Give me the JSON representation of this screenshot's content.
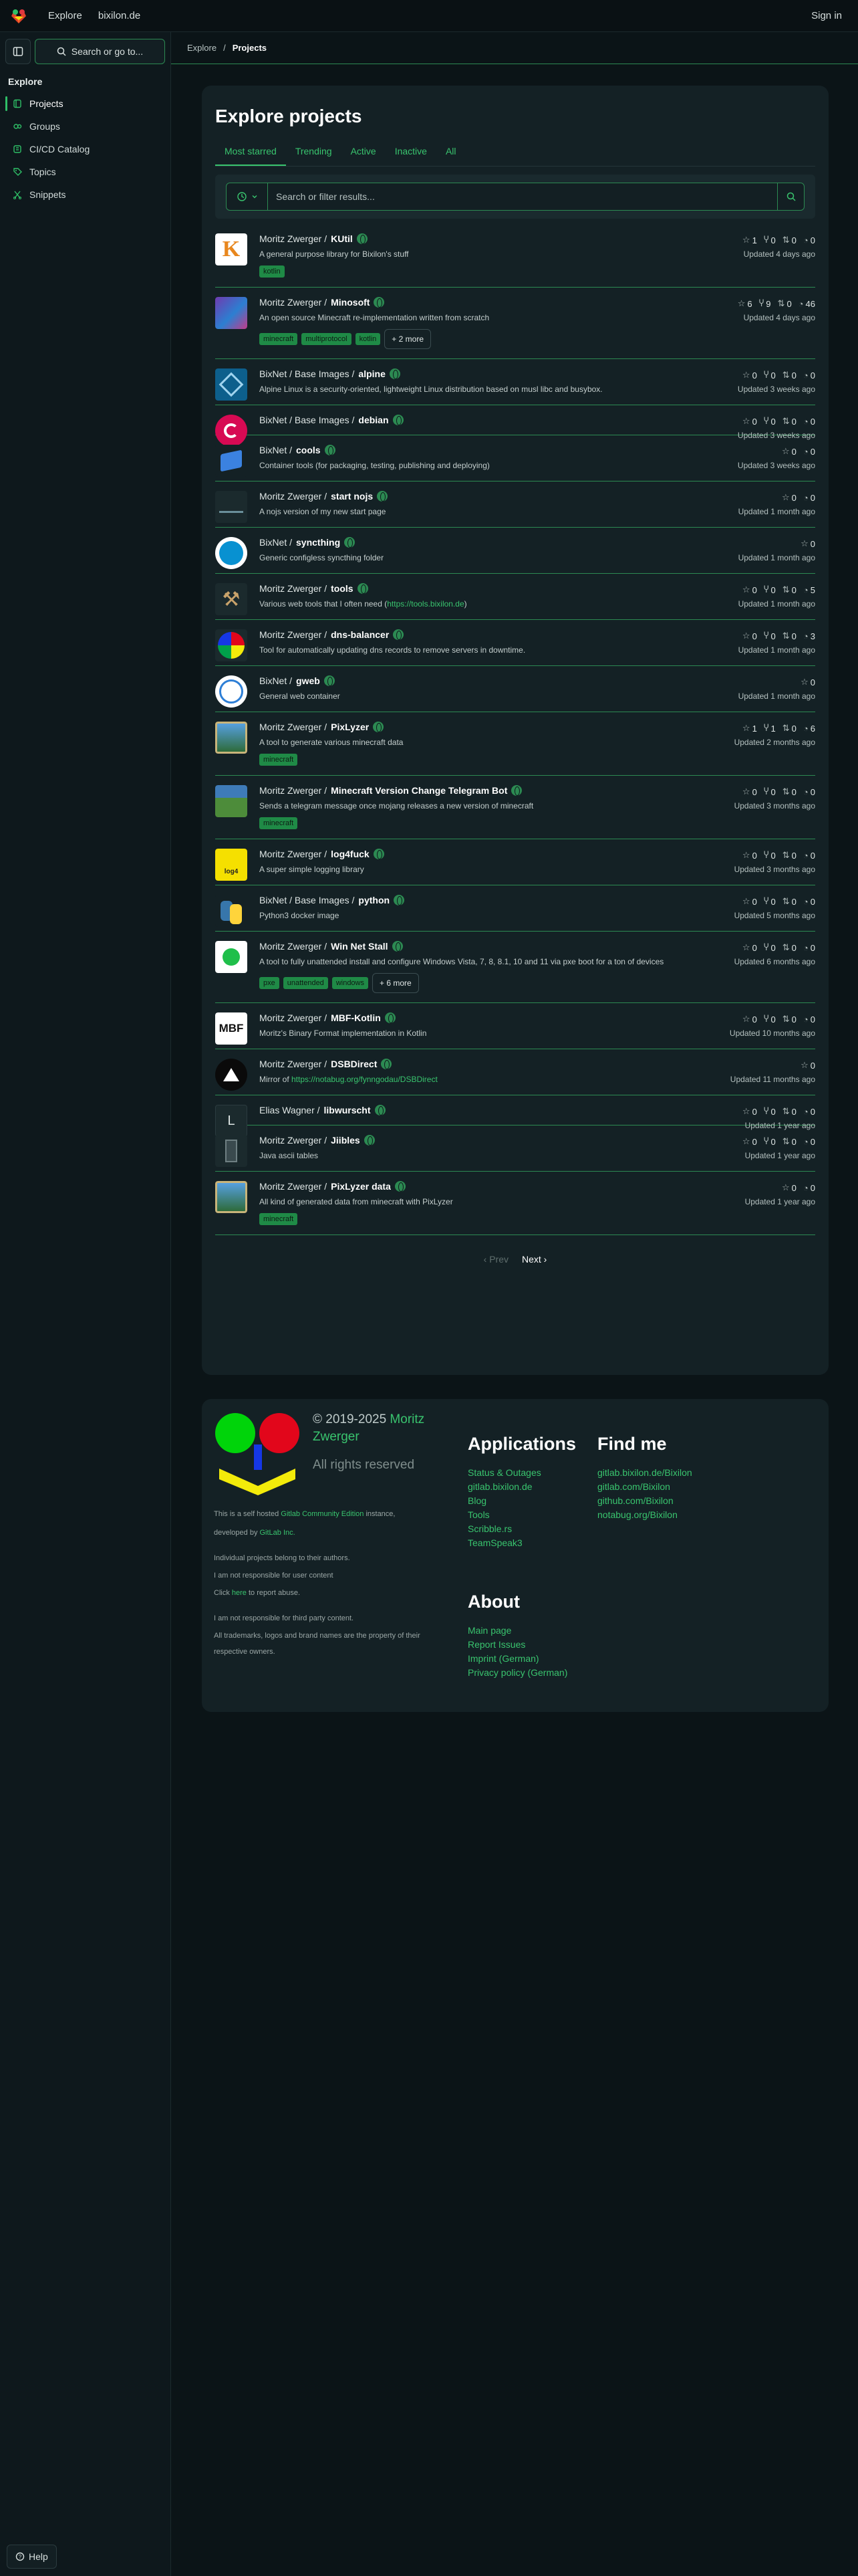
{
  "topbar": {
    "explore": "Explore",
    "site": "bixilon.de",
    "signin": "Sign in"
  },
  "sidebar": {
    "search": "Search or go to...",
    "heading": "Explore",
    "items": [
      {
        "label": "Projects",
        "icon": "project-icon",
        "active": true
      },
      {
        "label": "Groups",
        "icon": "group-icon"
      },
      {
        "label": "CI/CD Catalog",
        "icon": "catalog-icon"
      },
      {
        "label": "Topics",
        "icon": "tag-icon"
      },
      {
        "label": "Snippets",
        "icon": "snippet-icon"
      }
    ],
    "help": "Help"
  },
  "breadcrumb": {
    "first": "Explore",
    "sep": "/",
    "current": "Projects"
  },
  "main": {
    "title": "Explore projects",
    "tabs": [
      "Most starred",
      "Trending",
      "Active",
      "Inactive",
      "All"
    ],
    "filter_placeholder": "Search or filter results..."
  },
  "projects": [
    {
      "ns": "Moritz Zwerger / ",
      "name": "KUtil",
      "desc": "A general purpose library for Bixilon's stuff",
      "topics": [
        "kotlin"
      ],
      "stars": "1",
      "forks": "0",
      "mrs": "0",
      "issues": "0",
      "updated": "Updated 4 days ago"
    },
    {
      "ns": "Moritz Zwerger / ",
      "name": "Minosoft",
      "desc": "An open source Minecraft re-implementation written from scratch",
      "topics": [
        "minecraft",
        "multiprotocol",
        "kotlin"
      ],
      "more": "+ 2 more",
      "stars": "6",
      "forks": "9",
      "mrs": "0",
      "issues": "46",
      "updated": "Updated 4 days ago"
    },
    {
      "ns": "BixNet / Base Images / ",
      "name": "alpine",
      "desc": "Alpine Linux is a security-oriented, lightweight Linux distribution based on musl libc and busybox.",
      "stars": "0",
      "forks": "0",
      "mrs": "0",
      "issues": "0",
      "updated": "Updated 3 weeks ago"
    },
    {
      "ns": "BixNet / Base Images / ",
      "name": "debian",
      "stars": "0",
      "forks": "0",
      "mrs": "0",
      "issues": "0",
      "updated": "Updated 3 weeks ago"
    },
    {
      "ns": "BixNet / ",
      "name": "cools",
      "desc": "Container tools (for packaging, testing, publishing and deploying)",
      "stars": "0",
      "issues": "0",
      "updated": "Updated 3 weeks ago"
    },
    {
      "ns": "Moritz Zwerger / ",
      "name": "start nojs",
      "desc": "A nojs version of my new start page",
      "stars": "0",
      "issues": "0",
      "updated": "Updated 1 month ago"
    },
    {
      "ns": "BixNet / ",
      "name": "syncthing",
      "desc": "Generic configless syncthing folder",
      "stars": "0",
      "updated": "Updated 1 month ago"
    },
    {
      "ns": "Moritz Zwerger / ",
      "name": "tools",
      "desc_pre": "Various web tools that I often need (",
      "desc_link": "https://tools.bixilon.de",
      "desc_post": ")",
      "stars": "0",
      "forks": "0",
      "mrs": "0",
      "issues": "5",
      "updated": "Updated 1 month ago"
    },
    {
      "ns": "Moritz Zwerger / ",
      "name": "dns-balancer",
      "desc": "Tool for automatically updating dns records to remove servers in downtime.",
      "stars": "0",
      "forks": "0",
      "mrs": "0",
      "issues": "3",
      "updated": "Updated 1 month ago"
    },
    {
      "ns": "BixNet / ",
      "name": "gweb",
      "desc": "General web container",
      "stars": "0",
      "updated": "Updated 1 month ago"
    },
    {
      "ns": "Moritz Zwerger / ",
      "name": "PixLyzer",
      "desc": "A tool to generate various minecraft data",
      "topics": [
        "minecraft"
      ],
      "stars": "1",
      "forks": "1",
      "mrs": "0",
      "issues": "6",
      "updated": "Updated 2 months ago"
    },
    {
      "ns": "Moritz Zwerger / ",
      "name": "Minecraft Version Change Telegram Bot",
      "desc": "Sends a telegram message once mojang releases a new version of minecraft",
      "topics": [
        "minecraft"
      ],
      "stars": "0",
      "forks": "0",
      "mrs": "0",
      "issues": "0",
      "updated": "Updated 3 months ago"
    },
    {
      "ns": "Moritz Zwerger / ",
      "name": "log4fuck",
      "desc": "A super simple logging library",
      "stars": "0",
      "forks": "0",
      "mrs": "0",
      "issues": "0",
      "updated": "Updated 3 months ago"
    },
    {
      "ns": "BixNet / Base Images / ",
      "name": "python",
      "desc": "Python3 docker image",
      "stars": "0",
      "forks": "0",
      "mrs": "0",
      "issues": "0",
      "updated": "Updated 5 months ago"
    },
    {
      "ns": "Moritz Zwerger / ",
      "name": "Win Net Stall",
      "desc": "A tool to fully unattended install and configure Windows Vista, 7, 8, 8.1, 10 and 11 via pxe boot for a ton of devices",
      "topics": [
        "pxe",
        "unattended",
        "windows"
      ],
      "more": "+ 6 more",
      "stars": "0",
      "forks": "0",
      "mrs": "0",
      "issues": "0",
      "updated": "Updated 6 months ago"
    },
    {
      "ns": "Moritz Zwerger / ",
      "name": "MBF-Kotlin",
      "desc": "Moritz's Binary Format implementation in Kotlin",
      "stars": "0",
      "forks": "0",
      "mrs": "0",
      "issues": "0",
      "updated": "Updated 10 months ago"
    },
    {
      "ns": "Moritz Zwerger / ",
      "name": "DSBDirect",
      "desc_pre": "Mirror of ",
      "desc_link": "https://notabug.org/fynngodau/DSBDirect",
      "desc_post": "",
      "stars": "0",
      "updated": "Updated 11 months ago"
    },
    {
      "ns": "Elias Wagner / ",
      "name": "libwurscht",
      "avatar_letter": "L",
      "stars": "0",
      "forks": "0",
      "mrs": "0",
      "issues": "0",
      "updated": "Updated 1 year ago"
    },
    {
      "ns": "Moritz Zwerger / ",
      "name": "Jiibles",
      "desc": "Java ascii tables",
      "stars": "0",
      "forks": "0",
      "mrs": "0",
      "issues": "0",
      "updated": "Updated 1 year ago"
    },
    {
      "ns": "Moritz Zwerger / ",
      "name": "PixLyzer data",
      "desc": "All kind of generated data from minecraft with PixLyzer",
      "topics": [
        "minecraft"
      ],
      "stars": "0",
      "issues": "0",
      "updated": "Updated 1 year ago"
    }
  ],
  "pager": {
    "prev": "‹ Prev",
    "next": "Next ›"
  },
  "footer": {
    "copyright": "© 2019-2025 ",
    "owner": "Moritz Zwerger",
    "rights": "All rights reserved",
    "self_hosted_pre": "This is a self hosted ",
    "self_hosted_link": "Gitlab Community Edition",
    "self_hosted_post": " instance,",
    "developed_pre": "developed by ",
    "developed_link": "GitLab Inc.",
    "l1": "Individual projects belong to their authors.",
    "l2": "I am not responsible for user content",
    "click_pre": "Click ",
    "click_link": "here",
    "click_post": " to report abuse.",
    "l4": "I am not responsible for third party content.",
    "l5": "All trademarks, logos and brand names are the property of their respective owners.",
    "apps_heading": "Applications",
    "apps": [
      "Status & Outages",
      "gitlab.bixilon.de",
      "Blog",
      "Tools",
      "Scribble.rs",
      "TeamSpeak3"
    ],
    "findme_heading": "Find me",
    "findme": [
      "gitlab.bixilon.de/Bixilon",
      "gitlab.com/Bixilon",
      "github.com/Bixilon",
      "notabug.org/Bixilon"
    ],
    "about_heading": "About",
    "about": [
      "Main page",
      "Report Issues",
      "Imprint (German)",
      "Privacy policy (German)"
    ]
  }
}
